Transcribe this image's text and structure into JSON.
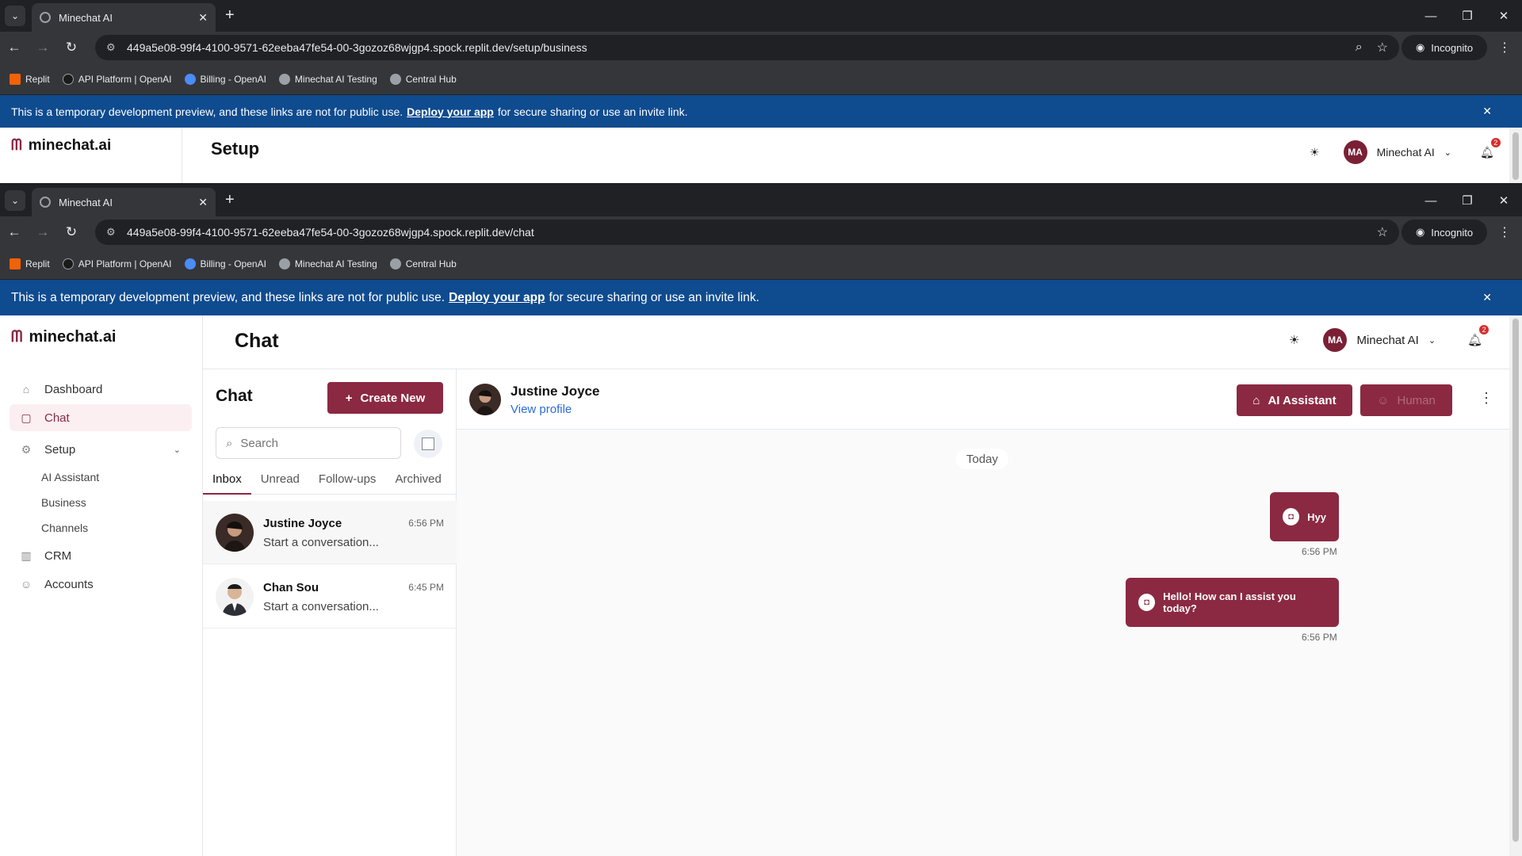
{
  "window1": {
    "tab_title": "Minechat AI",
    "url": "449a5e08-99f4-4100-9571-62eeba47fe54-00-3gozoz68wjgp4.spock.replit.dev/setup/business",
    "page_title": "Setup"
  },
  "window2": {
    "tab_title": "Minechat AI",
    "url": "449a5e08-99f4-4100-9571-62eeba47fe54-00-3gozoz68wjgp4.spock.replit.dev/chat",
    "page_title": "Chat"
  },
  "browser": {
    "incognito_label": "Incognito",
    "bookmarks": [
      "Replit",
      "API Platform | OpenAI",
      "Billing - OpenAI",
      "Minechat AI Testing",
      "Central Hub"
    ]
  },
  "banner": {
    "text_before": "This is a temporary development preview, and these links are not for public use.",
    "link": "Deploy your app",
    "text_after": "for secure sharing or use an invite link."
  },
  "app": {
    "logo": "minechat.ai",
    "user_initials": "MA",
    "user_name": "Minechat AI",
    "notification_count": "2"
  },
  "sidebar": {
    "items": [
      "Dashboard",
      "Chat",
      "Setup",
      "CRM",
      "Accounts"
    ],
    "setup_subitems": [
      "AI Assistant",
      "Business",
      "Channels"
    ]
  },
  "chatlist": {
    "title": "Chat",
    "create_label": "Create New",
    "search_placeholder": "Search",
    "tabs": [
      "Inbox",
      "Unread",
      "Follow-ups",
      "Archived"
    ],
    "conversations": [
      {
        "name": "Justine Joyce",
        "time": "6:56 PM",
        "preview": "Start a conversation..."
      },
      {
        "name": "Chan Sou",
        "time": "6:45 PM",
        "preview": "Start a conversation..."
      }
    ]
  },
  "chatpane": {
    "contact_name": "Justine Joyce",
    "view_profile": "View profile",
    "ai_button": "AI Assistant",
    "human_button": "Human",
    "date_divider": "Today",
    "messages": [
      {
        "text": "Hyy",
        "time": "6:56 PM"
      },
      {
        "text": "Hello! How can I assist you today?",
        "time": "6:56 PM"
      }
    ]
  },
  "colors": {
    "brand": "#8b2942",
    "banner": "#0f4b8f"
  }
}
